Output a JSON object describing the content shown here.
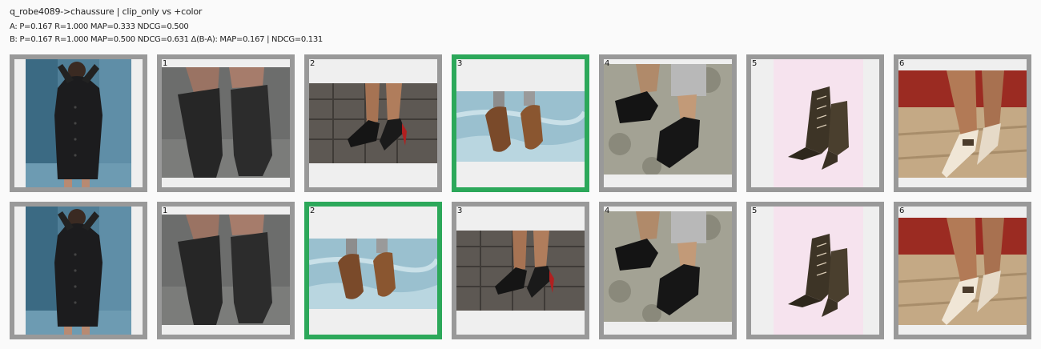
{
  "header": {
    "title": "q_robe4089->chaussure | clip_only vs +color",
    "metrics_a": "A: P=0.167 R=1.000 MAP=0.333 NDCG=0.500",
    "metrics_b": "B: P=0.167 R=1.000 MAP=0.500 NDCG=0.631 Δ(B-A): MAP=0.167 | NDCG=0.131"
  },
  "colors": {
    "hit_border": "#2ca85a",
    "tile_border": "#999999"
  },
  "rows": [
    {
      "query_icon": "woman-in-black-coat-photo",
      "results": [
        {
          "rank": "1",
          "icon": "black-knee-boots-photo",
          "hit": false
        },
        {
          "rank": "2",
          "icon": "black-red-sole-pumps-photo",
          "hit": false
        },
        {
          "rank": "3",
          "icon": "brown-loafers-photo",
          "hit": true
        },
        {
          "rank": "4",
          "icon": "black-slingback-loafers-photo",
          "hit": false
        },
        {
          "rank": "5",
          "icon": "dark-lace-up-ankle-boots-photo",
          "hit": false
        },
        {
          "rank": "6",
          "icon": "cream-pointed-flats-photo",
          "hit": false
        }
      ]
    },
    {
      "query_icon": "woman-in-black-coat-photo",
      "results": [
        {
          "rank": "1",
          "icon": "black-knee-boots-photo",
          "hit": false
        },
        {
          "rank": "2",
          "icon": "brown-loafers-photo",
          "hit": true
        },
        {
          "rank": "3",
          "icon": "black-red-sole-pumps-photo",
          "hit": false
        },
        {
          "rank": "4",
          "icon": "black-slingback-loafers-photo",
          "hit": false
        },
        {
          "rank": "5",
          "icon": "dark-lace-up-ankle-boots-photo",
          "hit": false
        },
        {
          "rank": "6",
          "icon": "cream-pointed-flats-photo",
          "hit": false
        }
      ]
    }
  ]
}
